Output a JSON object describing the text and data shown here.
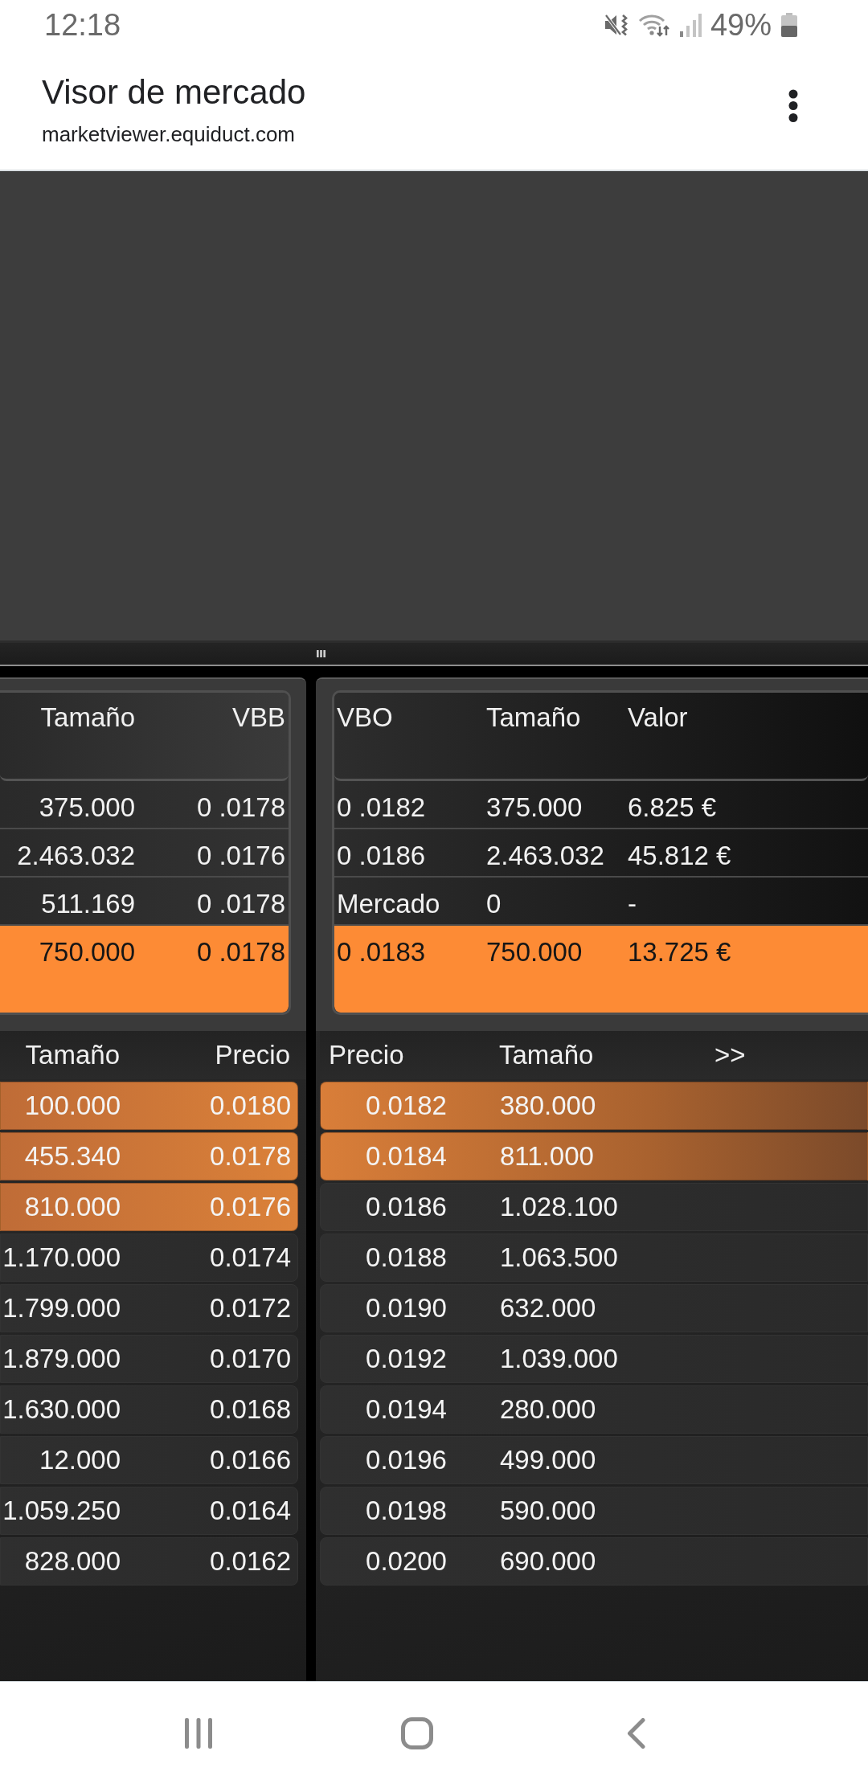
{
  "status_bar": {
    "time": "12:18",
    "battery": "49%"
  },
  "browser_bar": {
    "title": "Visor de mercado",
    "url": "marketviewer.equiduct.com"
  },
  "bid_quotes": {
    "columns": [
      "Tamaño",
      "VBB"
    ],
    "rows": [
      {
        "cells": [
          "375.000",
          "0 .0178"
        ],
        "highlighted": false
      },
      {
        "cells": [
          "2.463.032",
          "0 .0176"
        ],
        "highlighted": false
      },
      {
        "cells": [
          "511.169",
          "0 .0178"
        ],
        "highlighted": false
      },
      {
        "cells": [
          "750.000",
          "0 .0178"
        ],
        "highlighted": true
      }
    ]
  },
  "offer_quotes": {
    "columns": [
      "VBO",
      "Tamaño",
      "Valor"
    ],
    "rows": [
      {
        "cells": [
          "0 .0182",
          "375.000",
          "6.825 €"
        ],
        "highlighted": false
      },
      {
        "cells": [
          "0 .0186",
          "2.463.032",
          "45.812 €"
        ],
        "highlighted": false
      },
      {
        "cells": [
          "Mercado",
          "0",
          "-"
        ],
        "highlighted": false
      },
      {
        "cells": [
          "0 .0183",
          "750.000",
          "13.725 €"
        ],
        "highlighted": true
      }
    ]
  },
  "bid_book": {
    "columns": [
      "Tamaño",
      "Precio"
    ],
    "rows": [
      {
        "cells": [
          "100.000",
          "0.0180"
        ],
        "highlighted": true
      },
      {
        "cells": [
          "455.340",
          "0.0178"
        ],
        "highlighted": true
      },
      {
        "cells": [
          "810.000",
          "0.0176"
        ],
        "highlighted": true
      },
      {
        "cells": [
          "1.170.000",
          "0.0174"
        ],
        "highlighted": false
      },
      {
        "cells": [
          "1.799.000",
          "0.0172"
        ],
        "highlighted": false
      },
      {
        "cells": [
          "1.879.000",
          "0.0170"
        ],
        "highlighted": false
      },
      {
        "cells": [
          "1.630.000",
          "0.0168"
        ],
        "highlighted": false
      },
      {
        "cells": [
          "12.000",
          "0.0166"
        ],
        "highlighted": false
      },
      {
        "cells": [
          "1.059.250",
          "0.0164"
        ],
        "highlighted": false
      },
      {
        "cells": [
          "828.000",
          "0.0162"
        ],
        "highlighted": false
      }
    ]
  },
  "offer_book": {
    "columns": [
      "Precio",
      "Tamaño"
    ],
    "expand_toggle": ">>",
    "rows": [
      {
        "cells": [
          "0.0182",
          "380.000"
        ],
        "highlighted": true
      },
      {
        "cells": [
          "0.0184",
          "811.000"
        ],
        "highlighted": true
      },
      {
        "cells": [
          "0.0186",
          "1.028.100"
        ],
        "highlighted": false
      },
      {
        "cells": [
          "0.0188",
          "1.063.500"
        ],
        "highlighted": false
      },
      {
        "cells": [
          "0.0190",
          "632.000"
        ],
        "highlighted": false
      },
      {
        "cells": [
          "0.0192",
          "1.039.000"
        ],
        "highlighted": false
      },
      {
        "cells": [
          "0.0194",
          "280.000"
        ],
        "highlighted": false
      },
      {
        "cells": [
          "0.0196",
          "499.000"
        ],
        "highlighted": false
      },
      {
        "cells": [
          "0.0198",
          "590.000"
        ],
        "highlighted": false
      },
      {
        "cells": [
          "0.0200",
          "690.000"
        ],
        "highlighted": false
      }
    ]
  }
}
